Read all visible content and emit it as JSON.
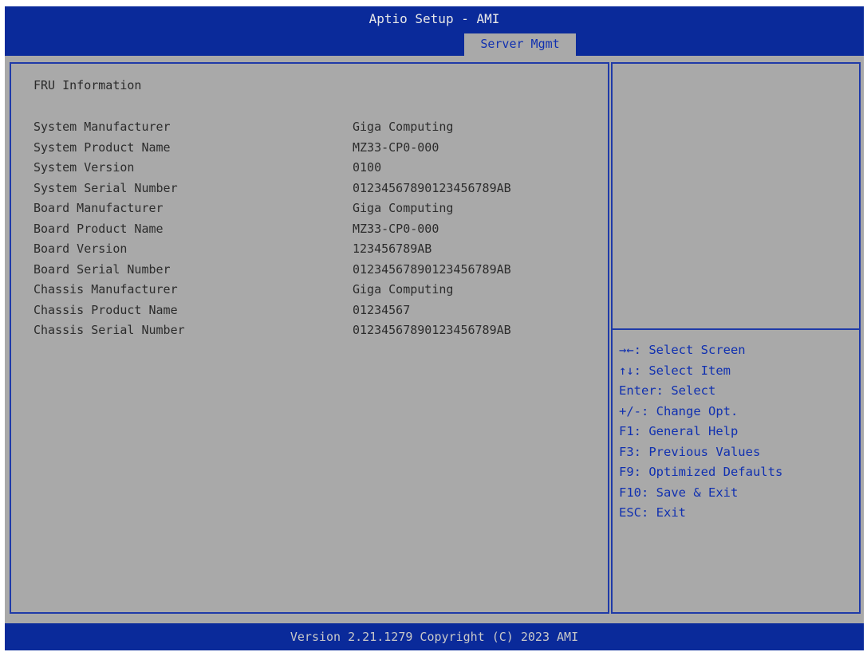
{
  "header": {
    "title": "Aptio Setup - AMI",
    "active_tab": "Server Mgmt"
  },
  "main": {
    "section_title": "FRU Information",
    "rows": [
      {
        "label": "System Manufacturer",
        "value": "Giga Computing"
      },
      {
        "label": "System Product Name",
        "value": "MZ33-CP0-000"
      },
      {
        "label": "System Version",
        "value": "0100"
      },
      {
        "label": "System Serial Number",
        "value": "01234567890123456789AB"
      },
      {
        "label": "Board Manufacturer",
        "value": "Giga Computing"
      },
      {
        "label": "Board Product Name",
        "value": "MZ33-CP0-000"
      },
      {
        "label": "Board Version",
        "value": "123456789AB"
      },
      {
        "label": "Board Serial Number",
        "value": "01234567890123456789AB"
      },
      {
        "label": "Chassis Manufacturer",
        "value": "Giga Computing"
      },
      {
        "label": "Chassis Product Name",
        "value": "01234567"
      },
      {
        "label": "Chassis Serial Number",
        "value": "01234567890123456789AB"
      }
    ]
  },
  "help": {
    "items": [
      "→←: Select Screen",
      "↑↓: Select Item",
      "Enter: Select",
      "+/-: Change Opt.",
      "F1: General Help",
      "F3: Previous Values",
      "F9: Optimized Defaults",
      "F10: Save & Exit",
      "ESC: Exit"
    ]
  },
  "footer": {
    "version_text": "Version 2.21.1279 Copyright (C) 2023 AMI"
  },
  "colors": {
    "header_blue": "#0a2a9a",
    "panel_gray": "#a9a9a9",
    "help_blue": "#1030b0"
  }
}
